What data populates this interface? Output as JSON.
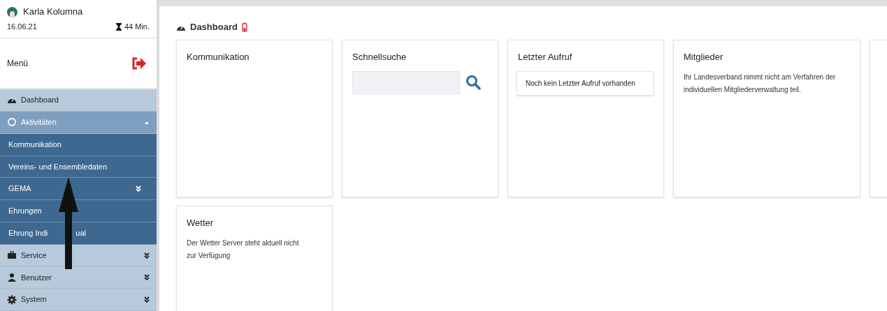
{
  "user": {
    "name": "Karla Kolumna",
    "date": "16.06.21",
    "session_time": "44 Min."
  },
  "menu": {
    "label": "Menü"
  },
  "sidebar": {
    "items": [
      {
        "label": "Dashboard"
      },
      {
        "label": "Aktivitäten",
        "expanded": true,
        "children": [
          {
            "label": "Kommunikation"
          },
          {
            "label": "Vereins- und Ensembledaten"
          },
          {
            "label": "GEMA",
            "expanded": false
          },
          {
            "label": "Ehrungen"
          },
          {
            "label": "Ehrung Indi",
            "label_tail": "ual"
          }
        ]
      },
      {
        "label": "Service",
        "expanded": false
      },
      {
        "label": "Benutzer",
        "expanded": false
      },
      {
        "label": "System",
        "expanded": false
      }
    ]
  },
  "page": {
    "title": "Dashboard"
  },
  "cards": [
    {
      "title": "Kommunikation",
      "kind": "empty"
    },
    {
      "title": "Schnellsuche",
      "kind": "search"
    },
    {
      "title": "Letzter Aufruf",
      "kind": "notice",
      "text": "Noch kein Letzter Aufruf vorhanden"
    },
    {
      "title": "Mitglieder",
      "kind": "text",
      "text": "Ihr Landesverband nimmt nicht am Verfahren der individuellen Mitgliederverwaltung teil."
    },
    {
      "kind": "empty"
    },
    {
      "title": "Wetter",
      "kind": "text",
      "text": "Der Wetter Server steht aktuell nicht zur Verfügung"
    }
  ]
}
